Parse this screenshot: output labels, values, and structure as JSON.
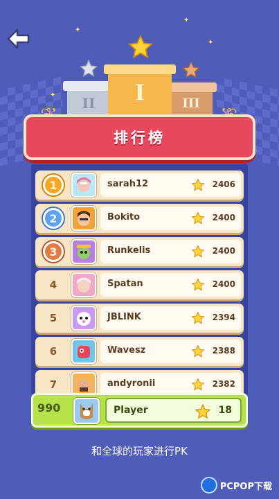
{
  "back_icon": "back-arrow-icon",
  "podium": {
    "labels": [
      "II",
      "I",
      "III"
    ]
  },
  "banner": {
    "title": "排行榜"
  },
  "leaderboard": [
    {
      "rank": "1",
      "name": "sarah12",
      "score": "2406",
      "medal": "gold"
    },
    {
      "rank": "2",
      "name": "Bokito",
      "score": "2400",
      "medal": "silver"
    },
    {
      "rank": "3",
      "name": "Runkelis",
      "score": "2400",
      "medal": "bronze"
    },
    {
      "rank": "4",
      "name": "Spatan",
      "score": "2400"
    },
    {
      "rank": "5",
      "name": "JBLINK",
      "score": "2394"
    },
    {
      "rank": "6",
      "name": "Wavesz",
      "score": "2388"
    },
    {
      "rank": "7",
      "name": "andyronii",
      "score": "2382"
    }
  ],
  "player": {
    "rank": "990",
    "name": "Player",
    "score": "18"
  },
  "caption": "和全球的玩家进行PK",
  "watermark": {
    "text": "PCPOP下载"
  },
  "colors": {
    "background": "#4f5cb8",
    "banner": "#e8485e",
    "row": "#f7e6c6",
    "player_bar": "#b6e24a"
  }
}
